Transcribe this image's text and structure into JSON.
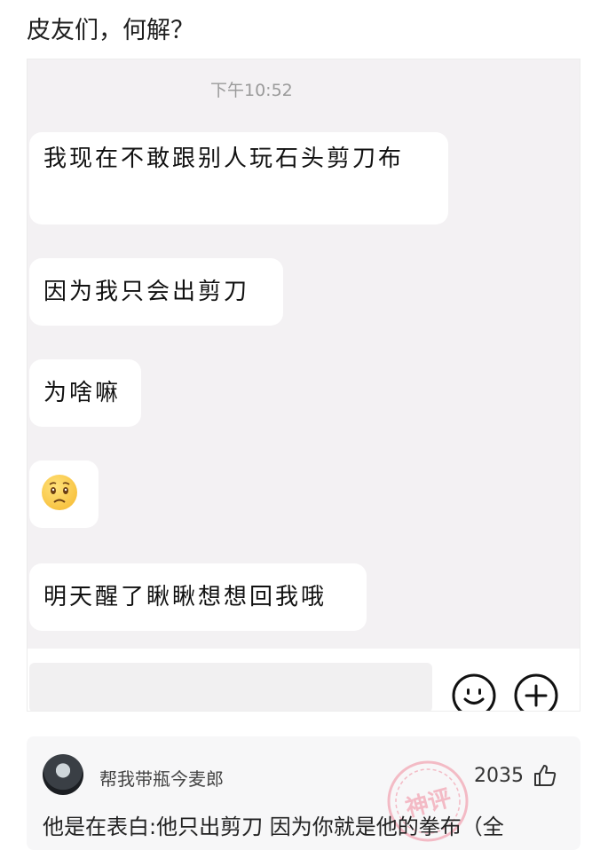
{
  "post": {
    "title": "皮友们，何解？"
  },
  "chat": {
    "timestamp": "下午10:52",
    "messages": [
      {
        "text": "我现在不敢跟别人玩石头剪刀布"
      },
      {
        "text": "因为我只会出剪刀"
      },
      {
        "text": "为啥嘛"
      },
      {
        "emoji": "pleading-face-icon"
      },
      {
        "text": "明天醒了瞅瞅想想回我哦"
      }
    ],
    "input_bar": {
      "emoji_button_icon": "smile-icon",
      "plus_button_icon": "plus-icon"
    }
  },
  "comment": {
    "username": "帮我带瓶今麦郎",
    "likes": "2035",
    "text": "他是在表白:他只出剪刀 因为你就是他的拳布（全",
    "stamp": "神评",
    "colors": {
      "stamp": "#f08a9c"
    }
  }
}
